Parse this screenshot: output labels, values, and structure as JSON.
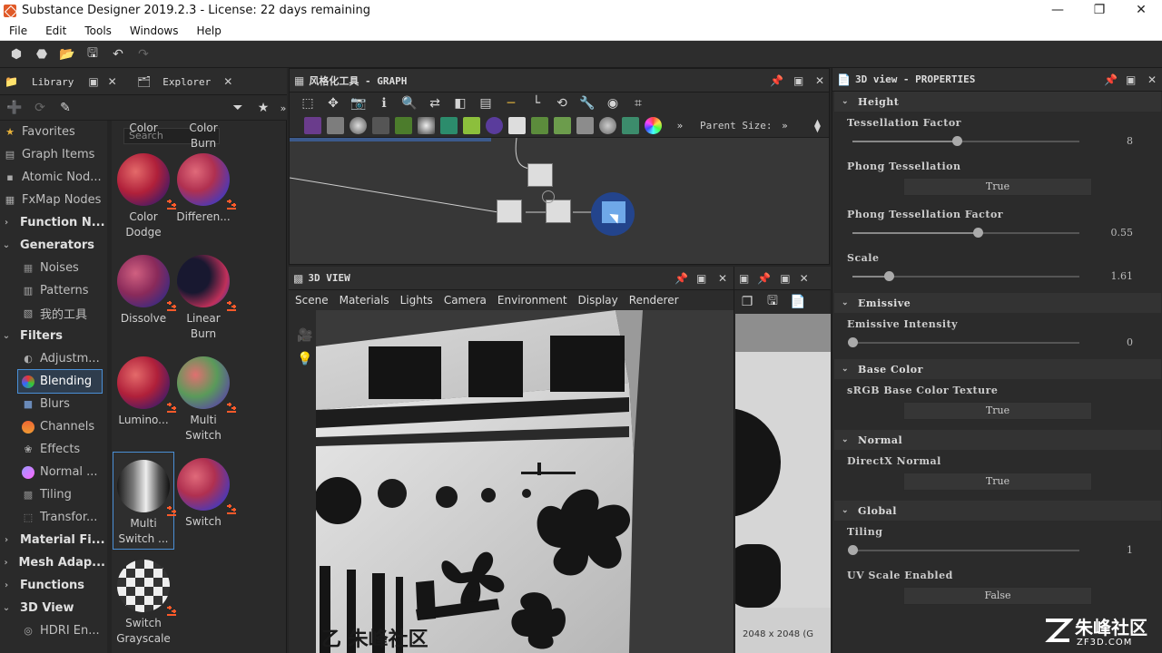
{
  "app": {
    "title": "Substance Designer 2019.2.3 - License: 22 days remaining",
    "window_buttons": [
      "—",
      "❐",
      "✕"
    ]
  },
  "menu": [
    "File",
    "Edit",
    "Tools",
    "Windows",
    "Help"
  ],
  "library": {
    "tabs": [
      {
        "label": "Library"
      },
      {
        "label": "Explorer"
      }
    ],
    "search_placeholder": "Search",
    "tree": [
      {
        "label": "Favorites",
        "icon": "star-icon",
        "type": "item"
      },
      {
        "label": "Graph Items",
        "icon": "graph-items-icon",
        "type": "item"
      },
      {
        "label": "Atomic Nod...",
        "icon": "atomic-nodes-icon",
        "type": "item"
      },
      {
        "label": "FxMap Nodes",
        "icon": "fxmap-icon",
        "type": "item"
      },
      {
        "label": "Function N...",
        "type": "collapsed"
      },
      {
        "label": "Generators",
        "type": "expanded"
      },
      {
        "label": "Noises",
        "icon": "noise-icon",
        "type": "child"
      },
      {
        "label": "Patterns",
        "icon": "pattern-icon",
        "type": "child"
      },
      {
        "label": "我的工具",
        "icon": "my-tools-icon",
        "type": "child"
      },
      {
        "label": "Filters",
        "type": "expanded"
      },
      {
        "label": "Adjustm...",
        "icon": "adjust-icon",
        "type": "child"
      },
      {
        "label": "Blending",
        "icon": "blending-icon",
        "type": "child",
        "selected": true
      },
      {
        "label": "Blurs",
        "icon": "blur-icon",
        "type": "child"
      },
      {
        "label": "Channels",
        "icon": "channels-icon",
        "type": "child"
      },
      {
        "label": "Effects",
        "icon": "effects-icon",
        "type": "child"
      },
      {
        "label": "Normal ...",
        "icon": "normal-icon",
        "type": "child"
      },
      {
        "label": "Tiling",
        "icon": "tiling-icon",
        "type": "child"
      },
      {
        "label": "Transfor...",
        "icon": "transform-icon",
        "type": "child"
      },
      {
        "label": "Material Fi...",
        "type": "collapsed"
      },
      {
        "label": "Mesh Adap...",
        "type": "collapsed"
      },
      {
        "label": "Functions",
        "type": "collapsed"
      },
      {
        "label": "3D View",
        "type": "expanded"
      },
      {
        "label": "HDRI En...",
        "icon": "hdri-icon",
        "type": "child"
      }
    ],
    "thumbnails": [
      {
        "label": "Color",
        "style": "none"
      },
      {
        "label": "Color\nBurn",
        "style": "none"
      },
      {
        "label": "Color\nDodge",
        "style": "red"
      },
      {
        "label": "Differen...",
        "style": "blue"
      },
      {
        "label": "Dissolve",
        "style": "dots"
      },
      {
        "label": "Linear\nBurn",
        "style": "dark"
      },
      {
        "label": "Lumino...",
        "style": "red"
      },
      {
        "label": "Multi\nSwitch",
        "style": "multi"
      },
      {
        "label": "Multi\nSwitch ...",
        "style": "gray",
        "selected": true
      },
      {
        "label": "Switch",
        "style": "blue"
      },
      {
        "label": "Switch\nGrayscale",
        "style": "checker"
      }
    ]
  },
  "graph": {
    "title": "风格化工具 - GRAPH",
    "parent_size_label": "Parent Size:"
  },
  "view3d": {
    "title": "3D VIEW",
    "menu": [
      "Scene",
      "Materials",
      "Lights",
      "Camera",
      "Environment",
      "Display",
      "Renderer"
    ]
  },
  "view2d": {
    "size_label": "2048 x 2048 (G"
  },
  "properties": {
    "title": "3D view - PROPERTIES",
    "sections": {
      "height": "Height",
      "emissive": "Emissive",
      "base_color": "Base Color",
      "normal": "Normal",
      "global": "Global"
    },
    "tessellation_factor": {
      "label": "Tessellation Factor",
      "value": "8",
      "fraction": 0.46
    },
    "phong_tessellation": {
      "label": "Phong Tessellation",
      "value": "True"
    },
    "phong_tessellation_factor": {
      "label": "Phong Tessellation Factor",
      "value": "0.55",
      "fraction": 0.55
    },
    "scale": {
      "label": "Scale",
      "value": "1.61",
      "fraction": 0.16
    },
    "emissive_intensity": {
      "label": "Emissive Intensity",
      "value": "0",
      "fraction": 0
    },
    "srgb_base_color": {
      "label": "sRGB Base Color Texture",
      "value": "True"
    },
    "directx_normal": {
      "label": "DirectX Normal",
      "value": "True"
    },
    "tiling": {
      "label": "Tiling",
      "value": "1",
      "fraction": 0
    },
    "uv_scale_enabled": {
      "label": "UV Scale Enabled",
      "value": "False"
    }
  },
  "watermark": {
    "text": "朱峰社区",
    "sub": "ZF3D.COM"
  }
}
